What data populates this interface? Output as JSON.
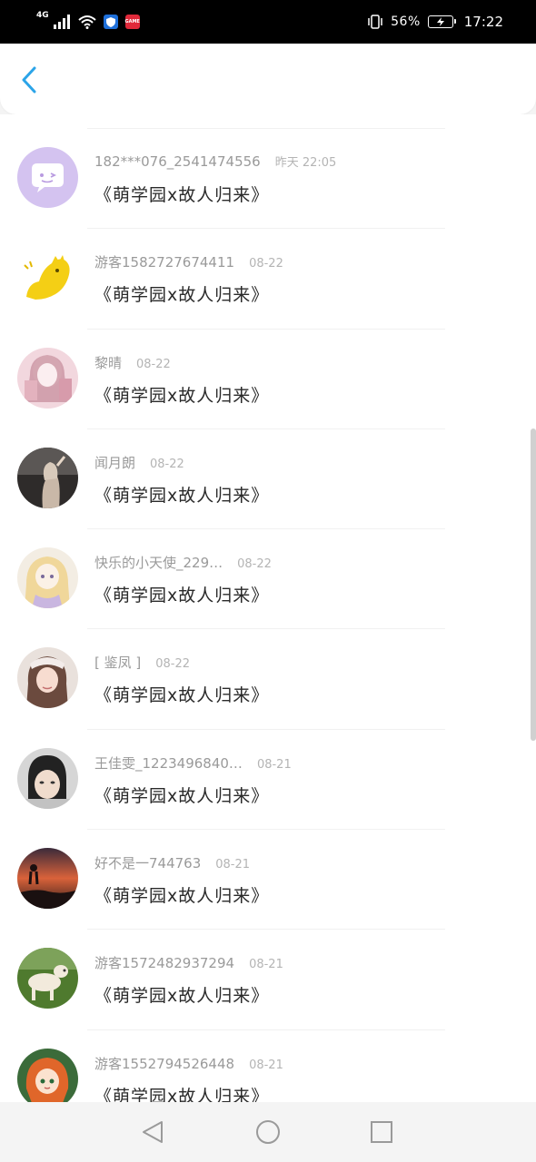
{
  "status_bar": {
    "network": "4G",
    "app_badge_label": "GAME",
    "battery_level": "56%",
    "time": "17:22"
  },
  "header": {
    "back_icon": "chevron-left-icon",
    "accent_color": "#2ba4e8"
  },
  "messages": [
    {
      "name": "182***076_2541474556",
      "time": "昨天 22:05",
      "text": "《萌学园x故人归来》",
      "avatar": "chat-bubble"
    },
    {
      "name": "游客1582727674411",
      "time": "08-22",
      "text": "《萌学园x故人归来》",
      "avatar": "yellow-dino"
    },
    {
      "name": "黎晴",
      "time": "08-22",
      "text": "《萌学园x故人归来》",
      "avatar": "anime-pink"
    },
    {
      "name": "闻月朗",
      "time": "08-22",
      "text": "《萌学园x故人归来》",
      "avatar": "photo-dark"
    },
    {
      "name": "快乐的小天使_229…",
      "time": "08-22",
      "text": "《萌学园x故人归来》",
      "avatar": "anime-light"
    },
    {
      "name": "[ 鉴凤 ]",
      "time": "08-22",
      "text": "《萌学园x故人归来》",
      "avatar": "girl-photo"
    },
    {
      "name": "王佳雯_1223496840…",
      "time": "08-21",
      "text": "《萌学园x故人归来》",
      "avatar": "face-photo"
    },
    {
      "name": "好不是一744763",
      "time": "08-21",
      "text": "《萌学园x故人归来》",
      "avatar": "sunset"
    },
    {
      "name": "游客1572482937294",
      "time": "08-21",
      "text": "《萌学园x故人归来》",
      "avatar": "dog"
    },
    {
      "name": "游客1552794526448",
      "time": "08-21",
      "text": "《萌学园x故人归来》",
      "avatar": "anime-red"
    }
  ],
  "nav_bar": {
    "back_icon": "triangle-back-icon",
    "home_icon": "circle-home-icon",
    "recent_icon": "square-recents-icon"
  }
}
